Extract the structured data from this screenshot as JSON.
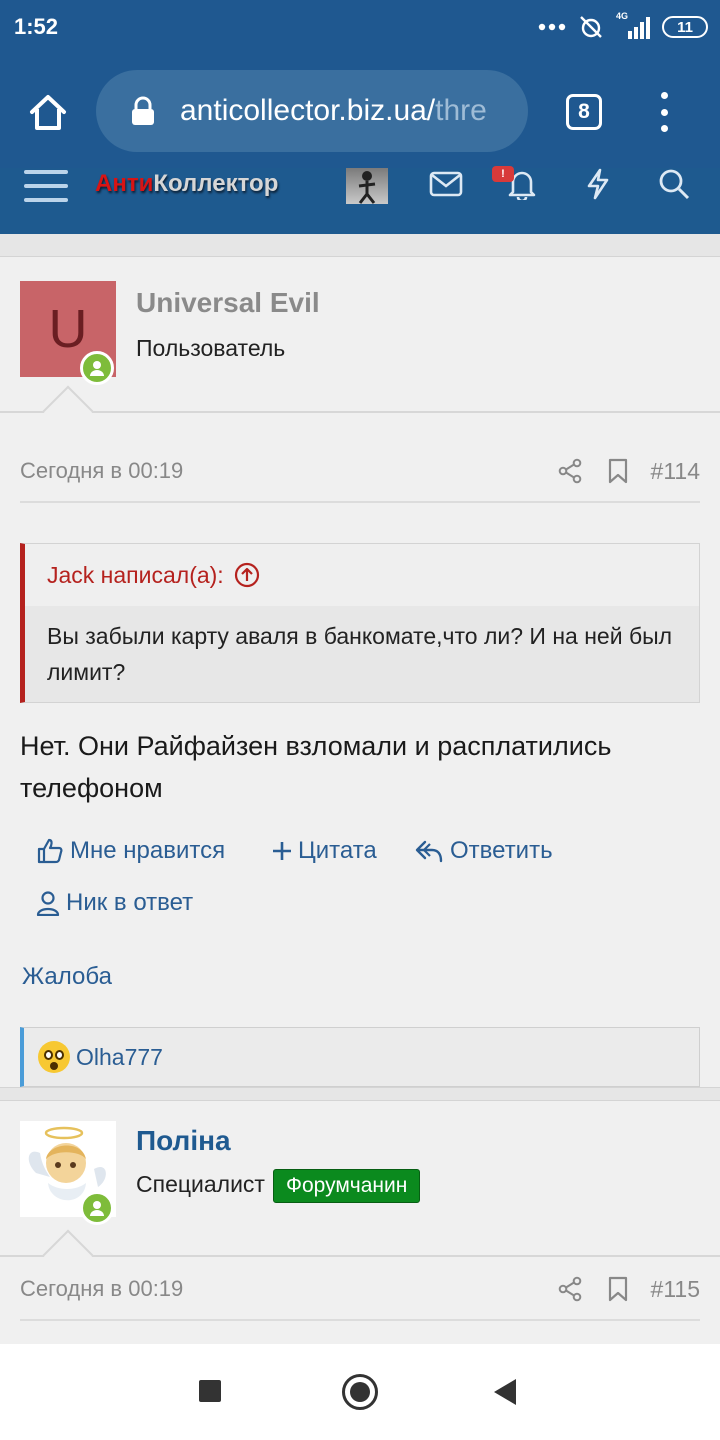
{
  "status_bar": {
    "time": "1:52",
    "network": "4G",
    "battery": "11"
  },
  "browser": {
    "url_main": "anticollector.biz.ua/",
    "url_faded": "thre",
    "tab_count": "8"
  },
  "forum": {
    "logo_red": "Анти",
    "logo_gray": "Коллектор",
    "notification_badge": "!"
  },
  "posts": [
    {
      "avatar_letter": "U",
      "username": "Universal Evil",
      "user_title": "Пользователь",
      "date": "Сегодня в 00:19",
      "post_number": "#114",
      "quote": {
        "author": "Jack написал(а):",
        "text": "Вы забыли карту аваля в банкомате,что ли? И на ней был лимит?"
      },
      "message": "Нет. Они Райфайзен взломали и расплатились телефоном",
      "actions": {
        "like": "Мне нравится",
        "quote": "Цитата",
        "reply": "Ответить",
        "nick": "Ник в ответ"
      },
      "report": "Жалоба",
      "reactions_user": "Olha777"
    },
    {
      "username": "Поліна",
      "user_title": "Специалист",
      "banner": "Форумчанин",
      "date": "Сегодня в 00:19",
      "post_number": "#115"
    }
  ],
  "colors": {
    "header_blue": "#1f5890",
    "link_blue": "#2a5d93",
    "quote_red": "#b5221e",
    "banner_green": "#0b8a1e",
    "online_green": "#7ebc3a"
  },
  "icons": {
    "home": "home-icon",
    "lock": "lock-icon",
    "menu": "more-vert-icon",
    "mail": "mail-icon",
    "bell": "bell-icon",
    "bolt": "lightning-icon",
    "search": "search-icon",
    "share": "share-icon",
    "bookmark": "bookmark-icon"
  }
}
